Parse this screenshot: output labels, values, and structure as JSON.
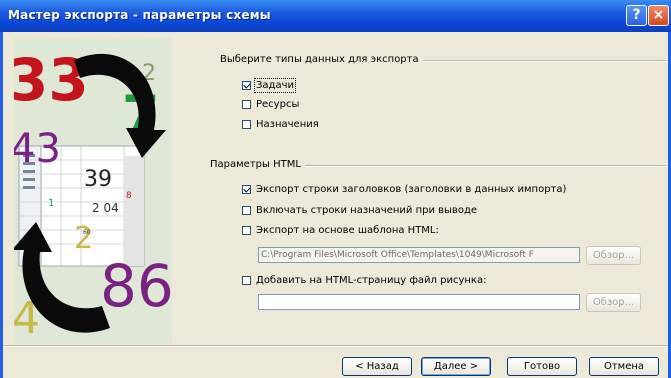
{
  "window": {
    "title": "Мастер экспорта - параметры схемы",
    "help_glyph": "?",
    "close_glyph": "×"
  },
  "side_image": {
    "numbers": [
      "33",
      "7",
      "43",
      "39",
      "2 04",
      "2",
      "86",
      "4",
      "1",
      "8",
      "2",
      "60"
    ]
  },
  "data_types": {
    "title": "Выберите типы данных для экспорта",
    "items": [
      {
        "label": "Задачи",
        "checked": true
      },
      {
        "label": "Ресурсы",
        "checked": false
      },
      {
        "label": "Назначения",
        "checked": false
      }
    ]
  },
  "html_params": {
    "title": "Параметры HTML",
    "items": [
      {
        "label": "Экспорт строки заголовков (заголовки в данных импорта)",
        "checked": true
      },
      {
        "label": "Включать строки назначений при выводе",
        "checked": false
      },
      {
        "label": "Экспорт на основе шаблона HTML:",
        "checked": false
      }
    ],
    "template_path": "C:\\Program Files\\Microsoft Office\\Templates\\1049\\Microsoft F",
    "browse1": "Обзор...",
    "image_option": {
      "label": "Добавить на HTML-страницу файл рисунка:",
      "checked": false
    },
    "image_path": "",
    "browse2": "Обзор..."
  },
  "buttons": {
    "back": "< Назад",
    "next": "Далее >",
    "finish": "Готово",
    "cancel": "Отмена"
  },
  "colors": {
    "title_bar": "#0a48d6",
    "window_bg": "#ece9d8",
    "image_red": "#c4141c",
    "image_green": "#1e9a3c",
    "image_purple": "#7a2184"
  }
}
